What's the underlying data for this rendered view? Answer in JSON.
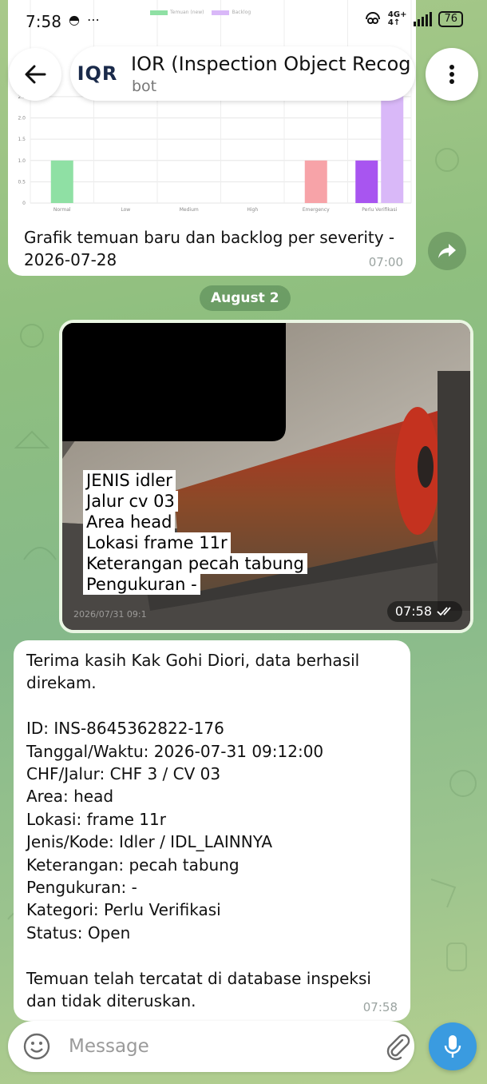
{
  "status_bar": {
    "time": "7:58",
    "left_icons": "◓ ⋯",
    "network_top": "4G+",
    "network_bottom": "4↑",
    "battery": "76"
  },
  "header": {
    "avatar_logo": "IQR",
    "title": "IOR (Inspection Object Recog",
    "subtitle": "bot"
  },
  "chart_message": {
    "caption": "Grafik temuan baru dan backlog per severity - 2026-07-28",
    "time": "07:00"
  },
  "chart_data": {
    "type": "bar",
    "categories": [
      "Normal",
      "Low",
      "Medium",
      "High",
      "Emergency",
      "Perlu Verifikasi"
    ],
    "y_ticks": [
      "2.5",
      "2.0",
      "1.5",
      "1.0",
      "0.5",
      "0"
    ],
    "ylim": [
      0,
      3
    ],
    "series": [
      {
        "name": "Temuan (new)",
        "values": [
          1,
          0,
          0,
          0,
          1,
          1
        ],
        "colors": [
          "#8fe0a4",
          "#8fe0a4",
          "#8fe0a4",
          "#8fe0a4",
          "#f7a3a8",
          "#a855f0"
        ]
      },
      {
        "name": "Backlog",
        "values": [
          0,
          0,
          0,
          0,
          0,
          3
        ],
        "colors": [
          "#d9b8f8",
          "#d9b8f8",
          "#d9b8f8",
          "#d9b8f8",
          "#d9b8f8",
          "#d9b8f8"
        ]
      }
    ],
    "legend": [
      "Temuan (new)",
      "Backlog"
    ],
    "grid": true
  },
  "date_separator": "August 2",
  "photo_message": {
    "caption_lines": [
      "JENIS idler",
      "Jalur cv 03",
      "Area head",
      "Lokasi frame 11r",
      "Keterangan pecah tabung",
      "Pengukuran -"
    ],
    "stamp": "2026/07/31 09:1",
    "time": "07:58"
  },
  "text_message": {
    "lines": [
      "Terima kasih Kak Gohi Diori, data berhasil",
      "direkam.",
      "",
      "ID: INS-8645362822-176",
      "Tanggal/Waktu: 2026-07-31 09:12:00",
      "CHF/Jalur: CHF 3 / CV 03",
      "Area: head",
      "Lokasi: frame 11r",
      "Jenis/Kode: Idler / IDL_LAINNYA",
      "Keterangan: pecah tabung",
      "Pengukuran: -",
      "Kategori: Perlu Verifikasi",
      "Status: Open",
      "",
      "Temuan telah tercatat di database inspeksi",
      "dan tidak diteruskan."
    ],
    "time": "07:58"
  },
  "input": {
    "placeholder": "Message"
  },
  "colors": {
    "accent": "#3a9be0",
    "bubble": "#ffffff",
    "date_chip": "#6b9b63"
  }
}
